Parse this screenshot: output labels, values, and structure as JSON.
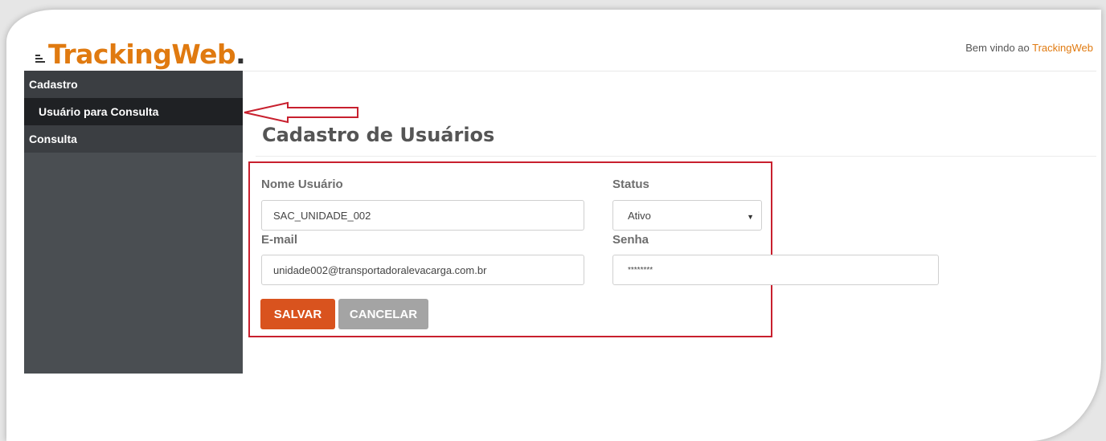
{
  "header": {
    "logo_text": "TrackingWeb",
    "logo_dot": ".",
    "welcome_prefix": "Bem vindo ao ",
    "welcome_brand": "TrackingWeb"
  },
  "sidebar": {
    "items": [
      {
        "label": "Cadastro",
        "type": "section"
      },
      {
        "label": "Usuário para Consulta",
        "type": "subitem",
        "active": true
      },
      {
        "label": "Consulta",
        "type": "section"
      }
    ]
  },
  "main": {
    "title": "Cadastro de Usuários",
    "fields": {
      "nome": {
        "label": "Nome Usuário",
        "value": "SAC_UNIDADE_002"
      },
      "status": {
        "label": "Status",
        "value": "Ativo"
      },
      "email": {
        "label": "E-mail",
        "value": "unidade002@transportadoralevacarga.com.br"
      },
      "senha": {
        "label": "Senha",
        "value": "********"
      }
    },
    "buttons": {
      "save": "SALVAR",
      "cancel": "CANCELAR"
    }
  },
  "colors": {
    "brand_orange": "#e07a10",
    "save_button": "#d9531e",
    "cancel_button": "#a4a4a4",
    "sidebar_bg": "#4a4e52",
    "highlight_red": "#c8202e"
  },
  "icons": {
    "arrow": "left-arrow-annotation-icon",
    "caret": "chevron-down-icon"
  }
}
